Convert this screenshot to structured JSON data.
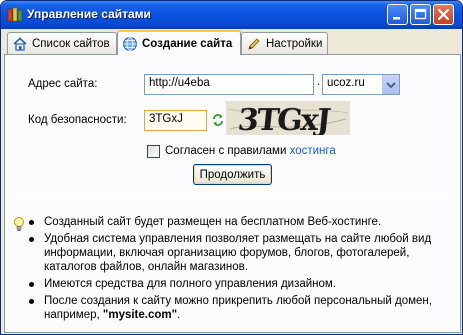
{
  "window": {
    "title": "Управление сайтами",
    "icons": {
      "app": "app-books-icon",
      "minimize": "minimize-icon",
      "maximize": "maximize-icon",
      "close": "close-icon"
    }
  },
  "tabs": [
    {
      "label": "Список сайтов",
      "icon": "house-list-icon",
      "active": false
    },
    {
      "label": "Создание сайта",
      "icon": "globe-icon",
      "active": true
    },
    {
      "label": "Настройки",
      "icon": "pencil-settings-icon",
      "active": false
    }
  ],
  "form": {
    "address_label": "Адрес сайта:",
    "address_value": "http://u4eba",
    "domain_separator": ".",
    "domain_selected": "ucoz.ru",
    "security_label": "Код безопасности:",
    "security_value": "3TGxJ",
    "captcha_text": "3TGxJ",
    "agree_prefix": "Согласен с правилами ",
    "agree_link": "хостинга",
    "agree_checked": false,
    "continue_button": "Продолжить"
  },
  "info": {
    "icon": "lightbulb-icon",
    "items": [
      "Созданный сайт будет размещен на бесплатном Веб-хостинге.",
      "Удобная система управления позволяет размещать на сайте любой вид информации, включая организацию форумов, блогов, фотогалерей, каталогов файлов, онлайн магазинов.",
      "Имеются средства для полного управления дизайном.",
      "После создания к сайту можно прикрепить любой персональный домен, например, "
    ],
    "example_domain": "\"mysite.com\"",
    "example_suffix": "."
  },
  "colors": {
    "titlebar": "#0a52de",
    "panel_bg": "#fcfcfe",
    "link": "#1b59c8",
    "active_tab_accent": "#ffc83c"
  }
}
